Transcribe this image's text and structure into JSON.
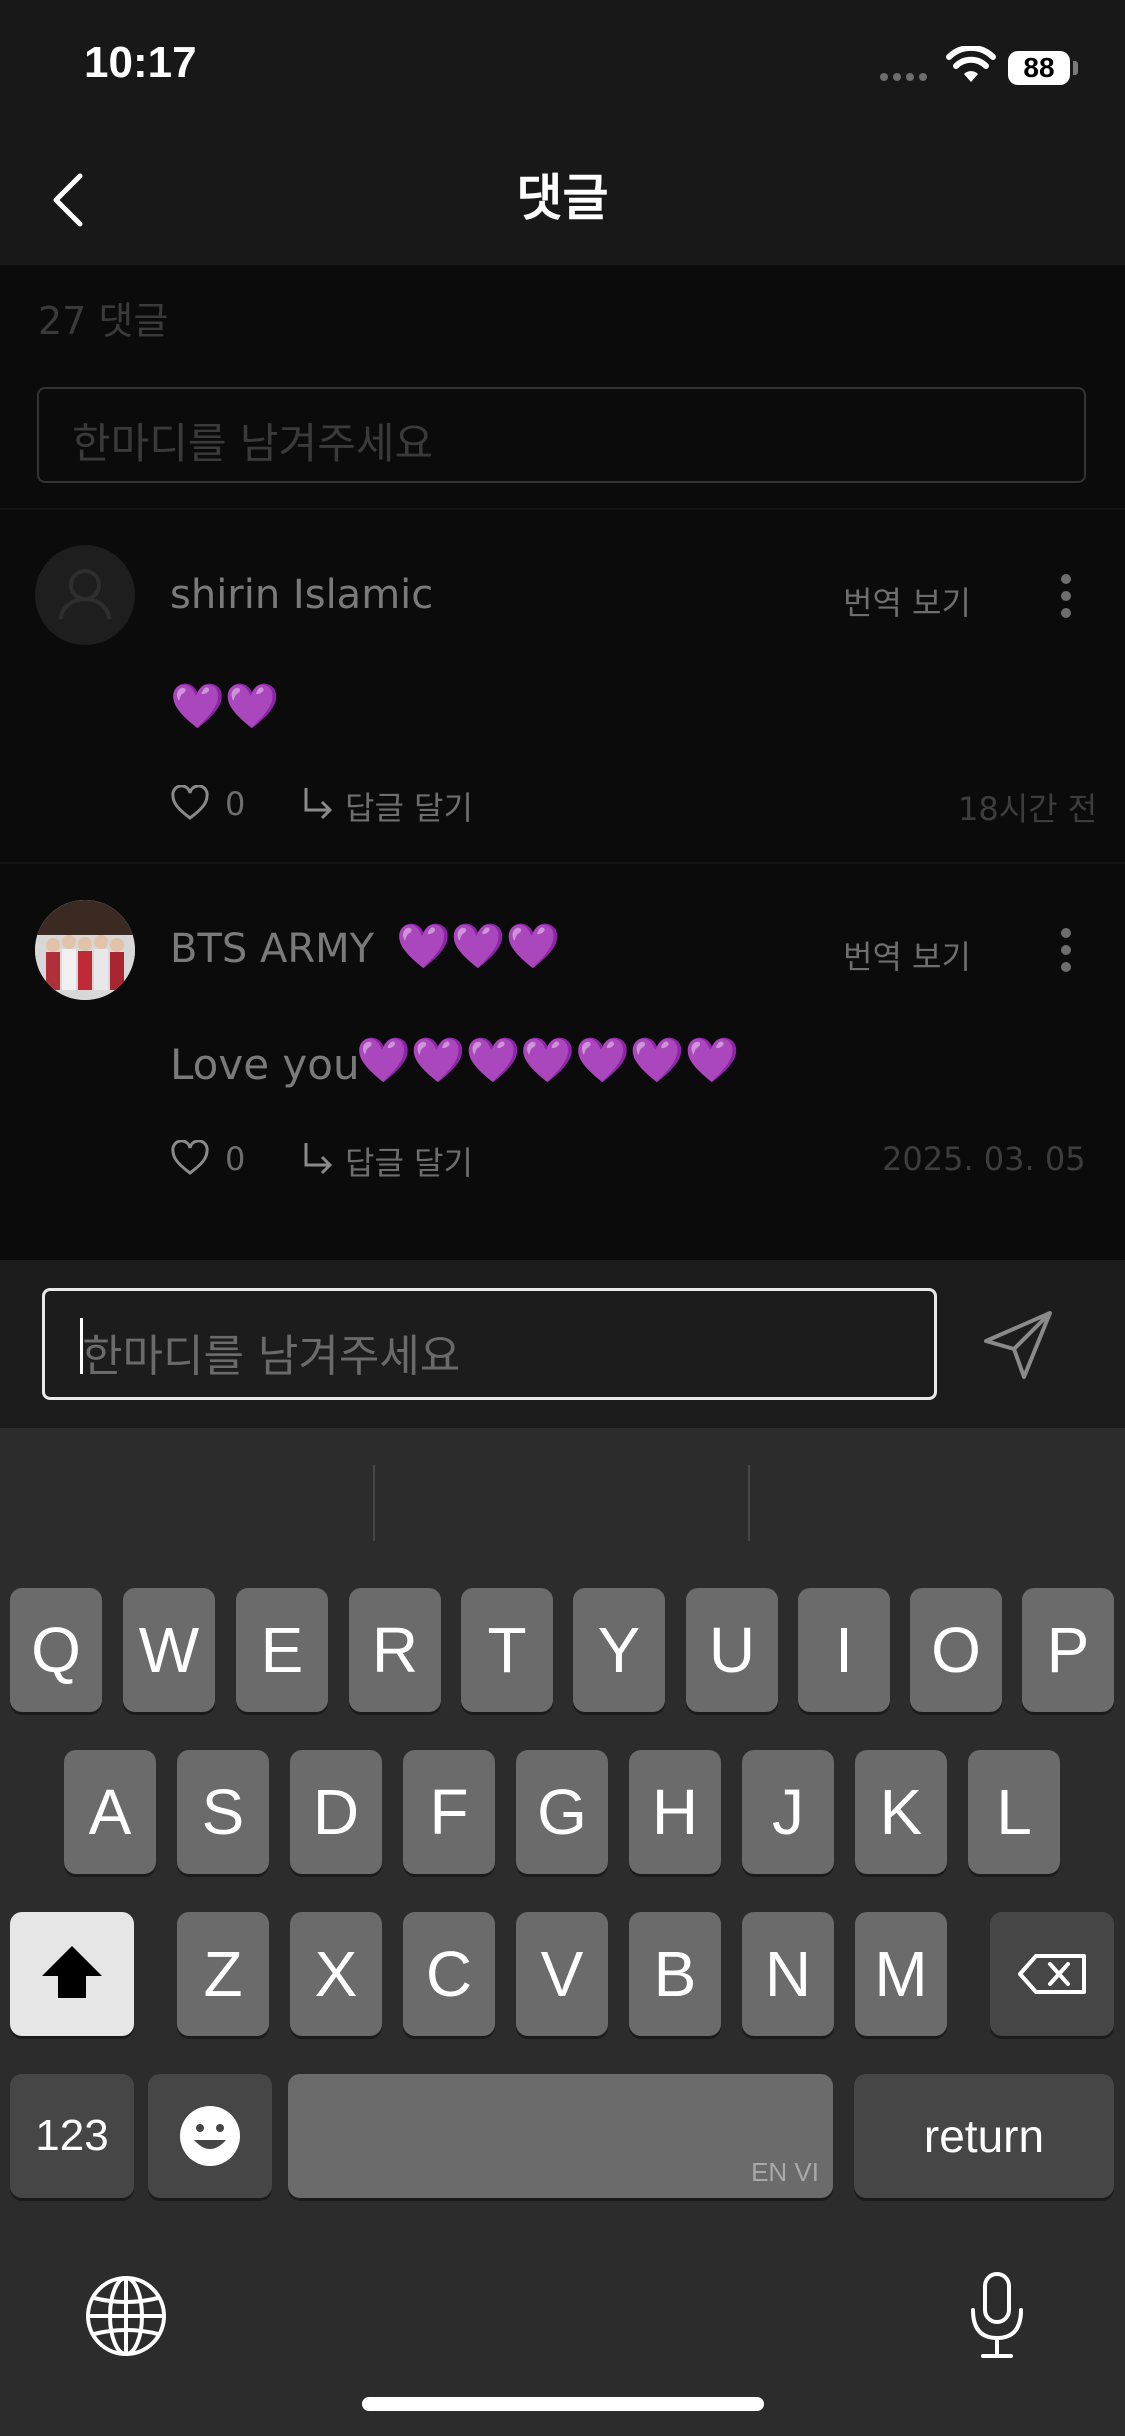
{
  "status_bar": {
    "time": "10:17",
    "battery": "88"
  },
  "header": {
    "title": "댓글"
  },
  "comments_count": "27 댓글",
  "top_input": {
    "placeholder": "한마디를 남겨주세요"
  },
  "comments": [
    {
      "username": "shirin Islamic",
      "translate": "번역 보기",
      "text": "💜💜",
      "likes": "0",
      "reply": "답글 달기",
      "timestamp": "18시간 전"
    },
    {
      "username": "BTS ARMY",
      "username_hearts": "💜💜💜",
      "translate": "번역 보기",
      "text": "Love you",
      "text_hearts": "💜💜💜💜💜💜💜",
      "likes": "0",
      "reply": "답글 달기",
      "timestamp": "2025. 03. 05"
    }
  ],
  "composer": {
    "placeholder": "한마디를 남겨주세요"
  },
  "keyboard": {
    "row1": [
      "Q",
      "W",
      "E",
      "R",
      "T",
      "Y",
      "U",
      "I",
      "O",
      "P"
    ],
    "row2": [
      "A",
      "S",
      "D",
      "F",
      "G",
      "H",
      "J",
      "K",
      "L"
    ],
    "row3": [
      "Z",
      "X",
      "C",
      "V",
      "B",
      "N",
      "M"
    ],
    "numbers_key": "123",
    "space_lang": "EN VI",
    "return_key": "return"
  },
  "icons": {
    "back": "chevron-left-icon",
    "heart": "heart-outline-icon",
    "reply": "reply-arrow-icon",
    "send": "paper-plane-icon",
    "globe": "globe-icon",
    "mic": "microphone-icon"
  }
}
